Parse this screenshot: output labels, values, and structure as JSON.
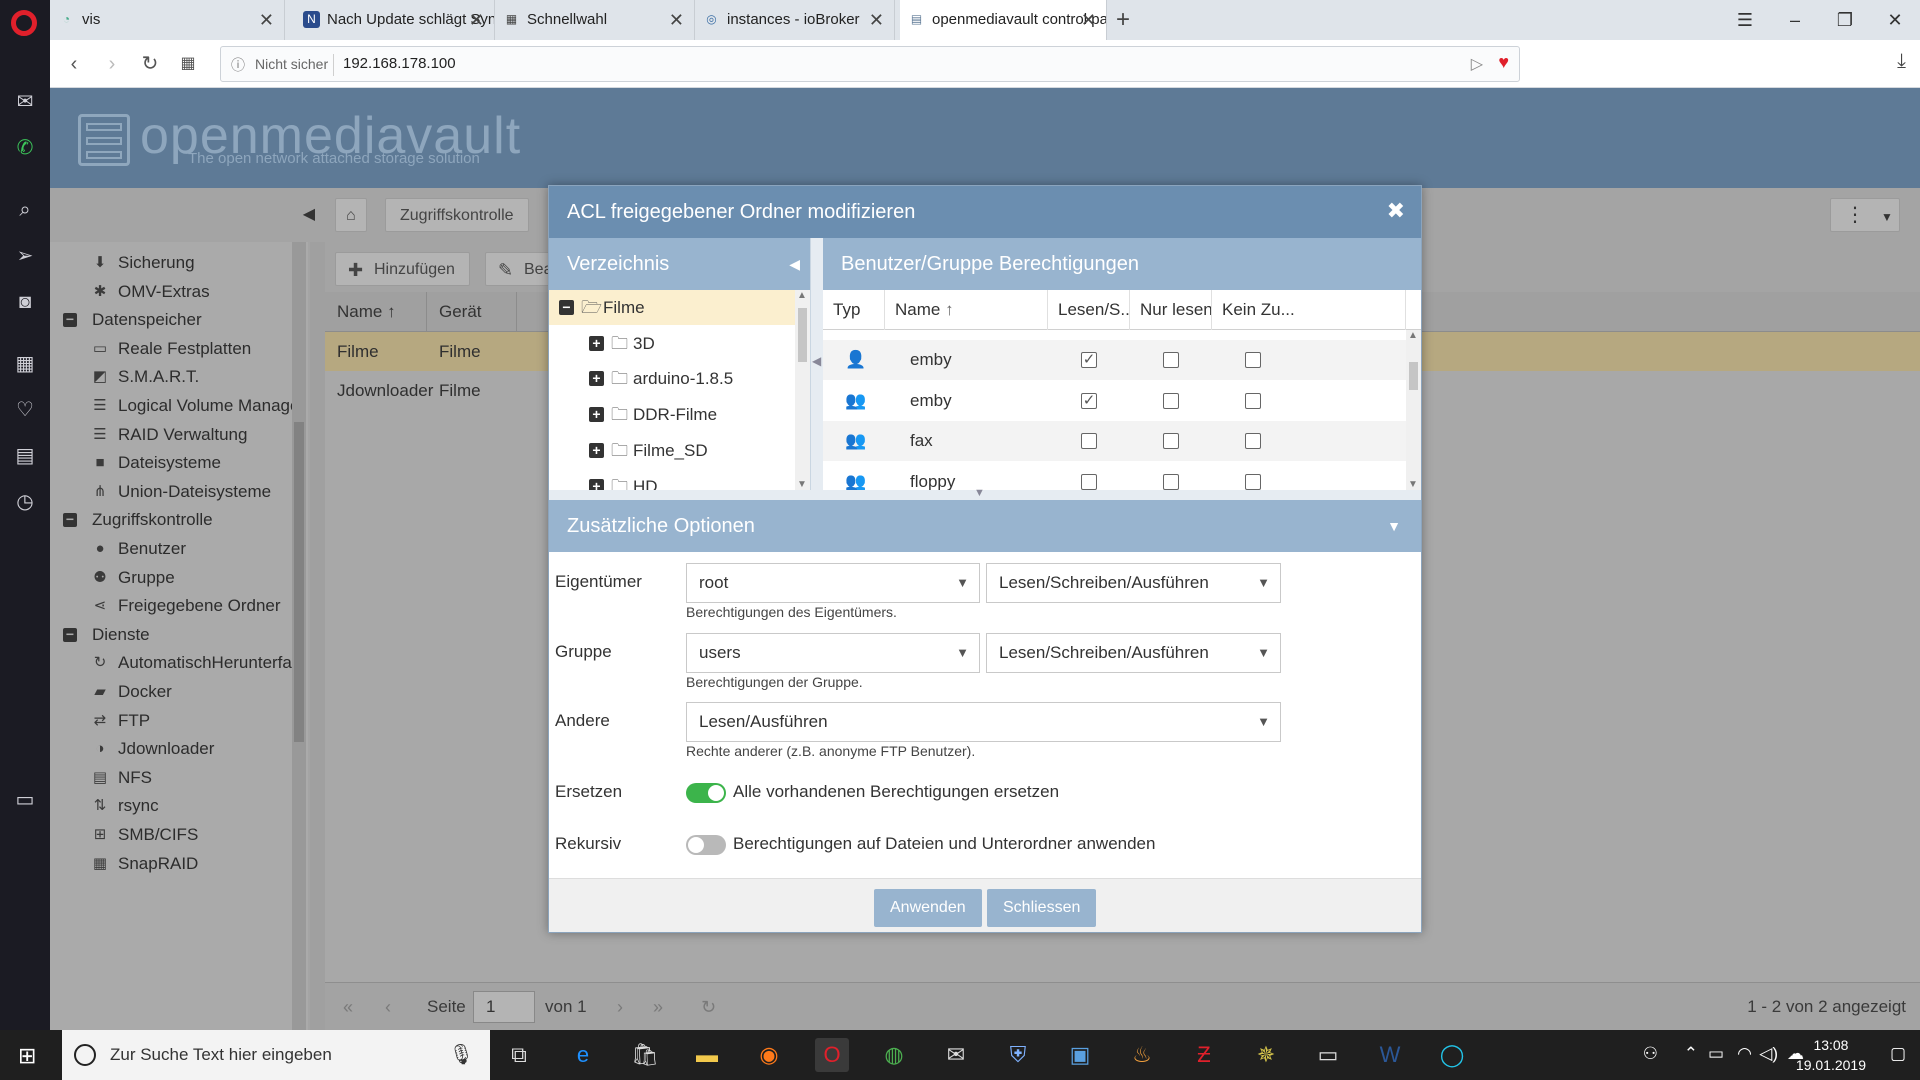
{
  "browser": {
    "tabs": [
      {
        "title": "vis",
        "icon": "vis-icon"
      },
      {
        "title": "Nach Update schlägt Sync",
        "icon": "forum-icon"
      },
      {
        "title": "Schnellwahl",
        "icon": "speed-dial-icon"
      },
      {
        "title": "instances - ioBroker",
        "icon": "iobroker-icon"
      },
      {
        "title": "openmediavault control pa",
        "icon": "document-icon"
      }
    ],
    "security_label": "Nicht sicher",
    "url": "192.168.178.100"
  },
  "omv": {
    "logo_text": "openmediavault",
    "logo_subtitle": "The open network attached storage solution",
    "breadcrumb": "Zugriffskontrolle",
    "sidebar": [
      {
        "type": "item",
        "label": "Sicherung",
        "icon": "backup-icon"
      },
      {
        "type": "item",
        "label": "OMV-Extras",
        "icon": "puzzle-icon"
      },
      {
        "type": "group",
        "label": "Datenspeicher"
      },
      {
        "type": "item",
        "label": "Reale Festplatten",
        "icon": "disk-icon"
      },
      {
        "type": "item",
        "label": "S.M.A.R.T.",
        "icon": "chart-icon"
      },
      {
        "type": "item",
        "label": "Logical Volume Manage",
        "icon": "database-icon"
      },
      {
        "type": "item",
        "label": "RAID Verwaltung",
        "icon": "database-icon"
      },
      {
        "type": "item",
        "label": "Dateisysteme",
        "icon": "folder-icon"
      },
      {
        "type": "item",
        "label": "Union-Dateisysteme",
        "icon": "sitemap-icon"
      },
      {
        "type": "group",
        "label": "Zugriffskontrolle"
      },
      {
        "type": "item",
        "label": "Benutzer",
        "icon": "user-icon"
      },
      {
        "type": "item",
        "label": "Gruppe",
        "icon": "users-icon"
      },
      {
        "type": "item",
        "label": "Freigegebene Ordner",
        "icon": "share-icon"
      },
      {
        "type": "group",
        "label": "Dienste"
      },
      {
        "type": "item",
        "label": "AutomatischHerunterfa",
        "icon": "refresh-icon"
      },
      {
        "type": "item",
        "label": "Docker",
        "icon": "docker-icon"
      },
      {
        "type": "item",
        "label": "FTP",
        "icon": "ftp-icon"
      },
      {
        "type": "item",
        "label": "Jdownloader",
        "icon": "jdownloader-icon"
      },
      {
        "type": "item",
        "label": "NFS",
        "icon": "file-icon"
      },
      {
        "type": "item",
        "label": "rsync",
        "icon": "rsync-icon"
      },
      {
        "type": "item",
        "label": "SMB/CIFS",
        "icon": "windows-icon"
      },
      {
        "type": "item",
        "label": "SnapRAID",
        "icon": "snapraid-icon"
      }
    ],
    "toolbar": {
      "add": "Hinzufügen",
      "edit": "Bea"
    },
    "grid": {
      "columns": [
        "Name",
        "Gerät"
      ],
      "rows": [
        {
          "name": "Filme",
          "device": "Filme"
        },
        {
          "name": "Jdownloader",
          "device": "Filme"
        }
      ]
    },
    "pager": {
      "page_label": "Seite",
      "page": "1",
      "of_label": "von 1",
      "status": "1 - 2 von 2 angezeigt"
    }
  },
  "dialog": {
    "title": "ACL freigegebener Ordner modifizieren",
    "directory_panel_title": "Verzeichnis",
    "directory_tree": [
      {
        "label": "Filme",
        "level": 0,
        "expanded": true,
        "selected": true
      },
      {
        "label": "3D",
        "level": 1
      },
      {
        "label": "arduino-1.8.5",
        "level": 1
      },
      {
        "label": "DDR-Filme",
        "level": 1
      },
      {
        "label": "Filme_SD",
        "level": 1
      },
      {
        "label": "HD",
        "level": 1
      }
    ],
    "permissions_panel_title": "Benutzer/Gruppe Berechtigungen",
    "permission_columns": [
      "Typ",
      "Name",
      "Lesen/S...",
      "Nur lesen",
      "Kein Zu..."
    ],
    "permission_rows": [
      {
        "type": "user",
        "name": "emby",
        "read_write": true,
        "read_only": false,
        "none": false
      },
      {
        "type": "group",
        "name": "emby",
        "read_write": true,
        "read_only": false,
        "none": false
      },
      {
        "type": "group",
        "name": "fax",
        "read_write": false,
        "read_only": false,
        "none": false
      },
      {
        "type": "group",
        "name": "floppy",
        "read_write": false,
        "read_only": false,
        "none": false
      }
    ],
    "options_title": "Zusätzliche Optionen",
    "owner": {
      "label": "Eigentümer",
      "value": "root",
      "permission": "Lesen/Schreiben/Ausführen",
      "hint": "Berechtigungen des Eigentümers."
    },
    "group": {
      "label": "Gruppe",
      "value": "users",
      "permission": "Lesen/Schreiben/Ausführen",
      "hint": "Berechtigungen der Gruppe."
    },
    "others": {
      "label": "Andere",
      "permission": "Lesen/Ausführen",
      "hint": "Rechte anderer (z.B. anonyme FTP Benutzer)."
    },
    "replace": {
      "label": "Ersetzen",
      "text": "Alle vorhandenen Berechtigungen ersetzen",
      "on": true
    },
    "recursive": {
      "label": "Rekursiv",
      "text": "Berechtigungen auf Dateien und Unterordner anwenden",
      "on": false
    },
    "apply_button": "Anwenden",
    "close_button": "Schliessen"
  },
  "taskbar": {
    "search_placeholder": "Zur Suche Text hier eingeben",
    "time": "13:08",
    "date": "19.01.2019"
  },
  "colors": {
    "omv_header": "#5e7a96",
    "dialog_header": "#6b8eb0",
    "panel_header": "#98b4cf",
    "toggle_on": "#3cb44b",
    "selected_row": "#fbefcf"
  }
}
